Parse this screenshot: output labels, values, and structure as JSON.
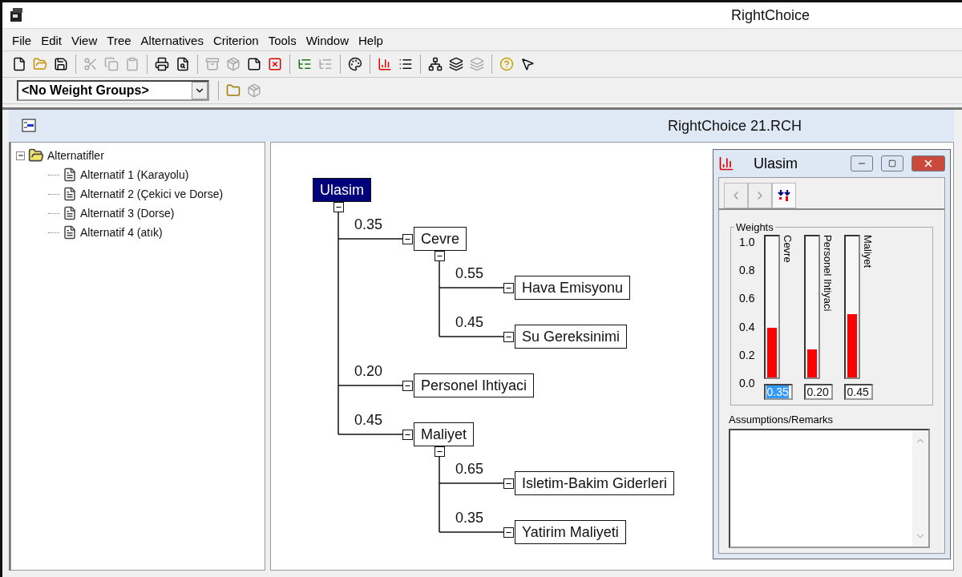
{
  "window": {
    "title": "RightChoice"
  },
  "menu": [
    "File",
    "Edit",
    "View",
    "Tree",
    "Alternatives",
    "Criterion",
    "Tools",
    "Window",
    "Help"
  ],
  "toolbar": [
    [
      {
        "kind": "new",
        "disabled": false
      },
      {
        "kind": "open",
        "disabled": false
      },
      {
        "kind": "save",
        "disabled": false
      }
    ],
    [
      {
        "kind": "cut",
        "disabled": true
      },
      {
        "kind": "copy",
        "disabled": true
      },
      {
        "kind": "paste",
        "disabled": true
      }
    ],
    [
      {
        "kind": "print",
        "disabled": false
      },
      {
        "kind": "preview",
        "disabled": false
      }
    ],
    [
      {
        "kind": "archive",
        "disabled": true
      },
      {
        "kind": "package",
        "disabled": true
      },
      {
        "kind": "note",
        "disabled": false
      },
      {
        "kind": "delete",
        "disabled": false
      }
    ],
    [
      {
        "kind": "list",
        "disabled": false
      },
      {
        "kind": "list",
        "disabled": true
      }
    ],
    [
      {
        "kind": "palette",
        "disabled": false
      }
    ],
    [
      {
        "kind": "chart",
        "disabled": false
      },
      {
        "kind": "tree",
        "disabled": false
      }
    ],
    [
      {
        "kind": "network",
        "disabled": false
      },
      {
        "kind": "layers",
        "disabled": false
      },
      {
        "kind": "layers",
        "disabled": true
      }
    ],
    [
      {
        "kind": "help",
        "disabled": false
      },
      {
        "kind": "pointer",
        "disabled": false
      }
    ]
  ],
  "weight_group": {
    "value": "<No Weight Groups>",
    "tools": [
      {
        "kind": "folder",
        "disabled": false
      },
      {
        "kind": "package",
        "disabled": true
      }
    ]
  },
  "document": {
    "title": "RightChoice 21.RCH"
  },
  "sidebar": {
    "label": "Alternatifler",
    "expanded": true,
    "children": [
      {
        "label": "Alternatif 1 (Karayolu)"
      },
      {
        "label": "Alternatif 2 (Çekici ve Dorse)"
      },
      {
        "label": "Alternatif 3 (Dorse)"
      },
      {
        "label": "Alternatif 4 (atık)"
      }
    ]
  },
  "diagram": {
    "name": "Ulasim",
    "selected": true,
    "children": [
      {
        "weight": "0.35",
        "name": "Cevre",
        "selected": false,
        "children": [
          {
            "weight": "0.55",
            "name": "Hava Emisyonu",
            "selected": false
          },
          {
            "weight": "0.45",
            "name": "Su Gereksinimi",
            "selected": false
          }
        ]
      },
      {
        "weight": "0.20",
        "name": "Personel Ihtiyaci",
        "selected": false
      },
      {
        "weight": "0.45",
        "name": "Maliyet",
        "selected": false,
        "children": [
          {
            "weight": "0.65",
            "name": "Isletim-Bakim Giderleri",
            "selected": false
          },
          {
            "weight": "0.35",
            "name": "Yatirim Maliyeti",
            "selected": false
          }
        ]
      }
    ]
  },
  "weights_dialog": {
    "title": "Ulasim",
    "group_label": "Weights",
    "scale": [
      "1.0",
      "0.8",
      "0.6",
      "0.4",
      "0.2",
      "0.0"
    ],
    "weights": [
      {
        "name": "Cevre",
        "level": 0.35,
        "reading": "0.35",
        "selected": true
      },
      {
        "name": "Personel Ihtiyaci",
        "level": 0.2,
        "reading": "0.20",
        "selected": false
      },
      {
        "name": "Maliyet",
        "level": 0.45,
        "reading": "0.45",
        "selected": false
      }
    ],
    "remarks_label": "Assumptions/Remarks"
  }
}
